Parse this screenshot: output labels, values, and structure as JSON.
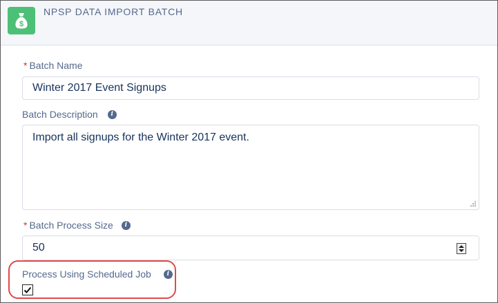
{
  "header": {
    "title": "NPSP DATA IMPORT BATCH",
    "icon": "money-bag-icon"
  },
  "fields": {
    "batch_name": {
      "label": "Batch Name",
      "required_marker": "*",
      "value": "Winter 2017 Event Signups"
    },
    "batch_description": {
      "label": "Batch Description",
      "value": "Import all signups for the Winter 2017 event."
    },
    "batch_process_size": {
      "label": "Batch Process Size",
      "required_marker": "*",
      "value": "50"
    },
    "process_using_scheduled_job": {
      "label": "Process Using Scheduled Job",
      "checked": true
    }
  },
  "colors": {
    "accent_icon": "#4bc076",
    "required": "#c23934",
    "highlight": "#e0484a"
  }
}
